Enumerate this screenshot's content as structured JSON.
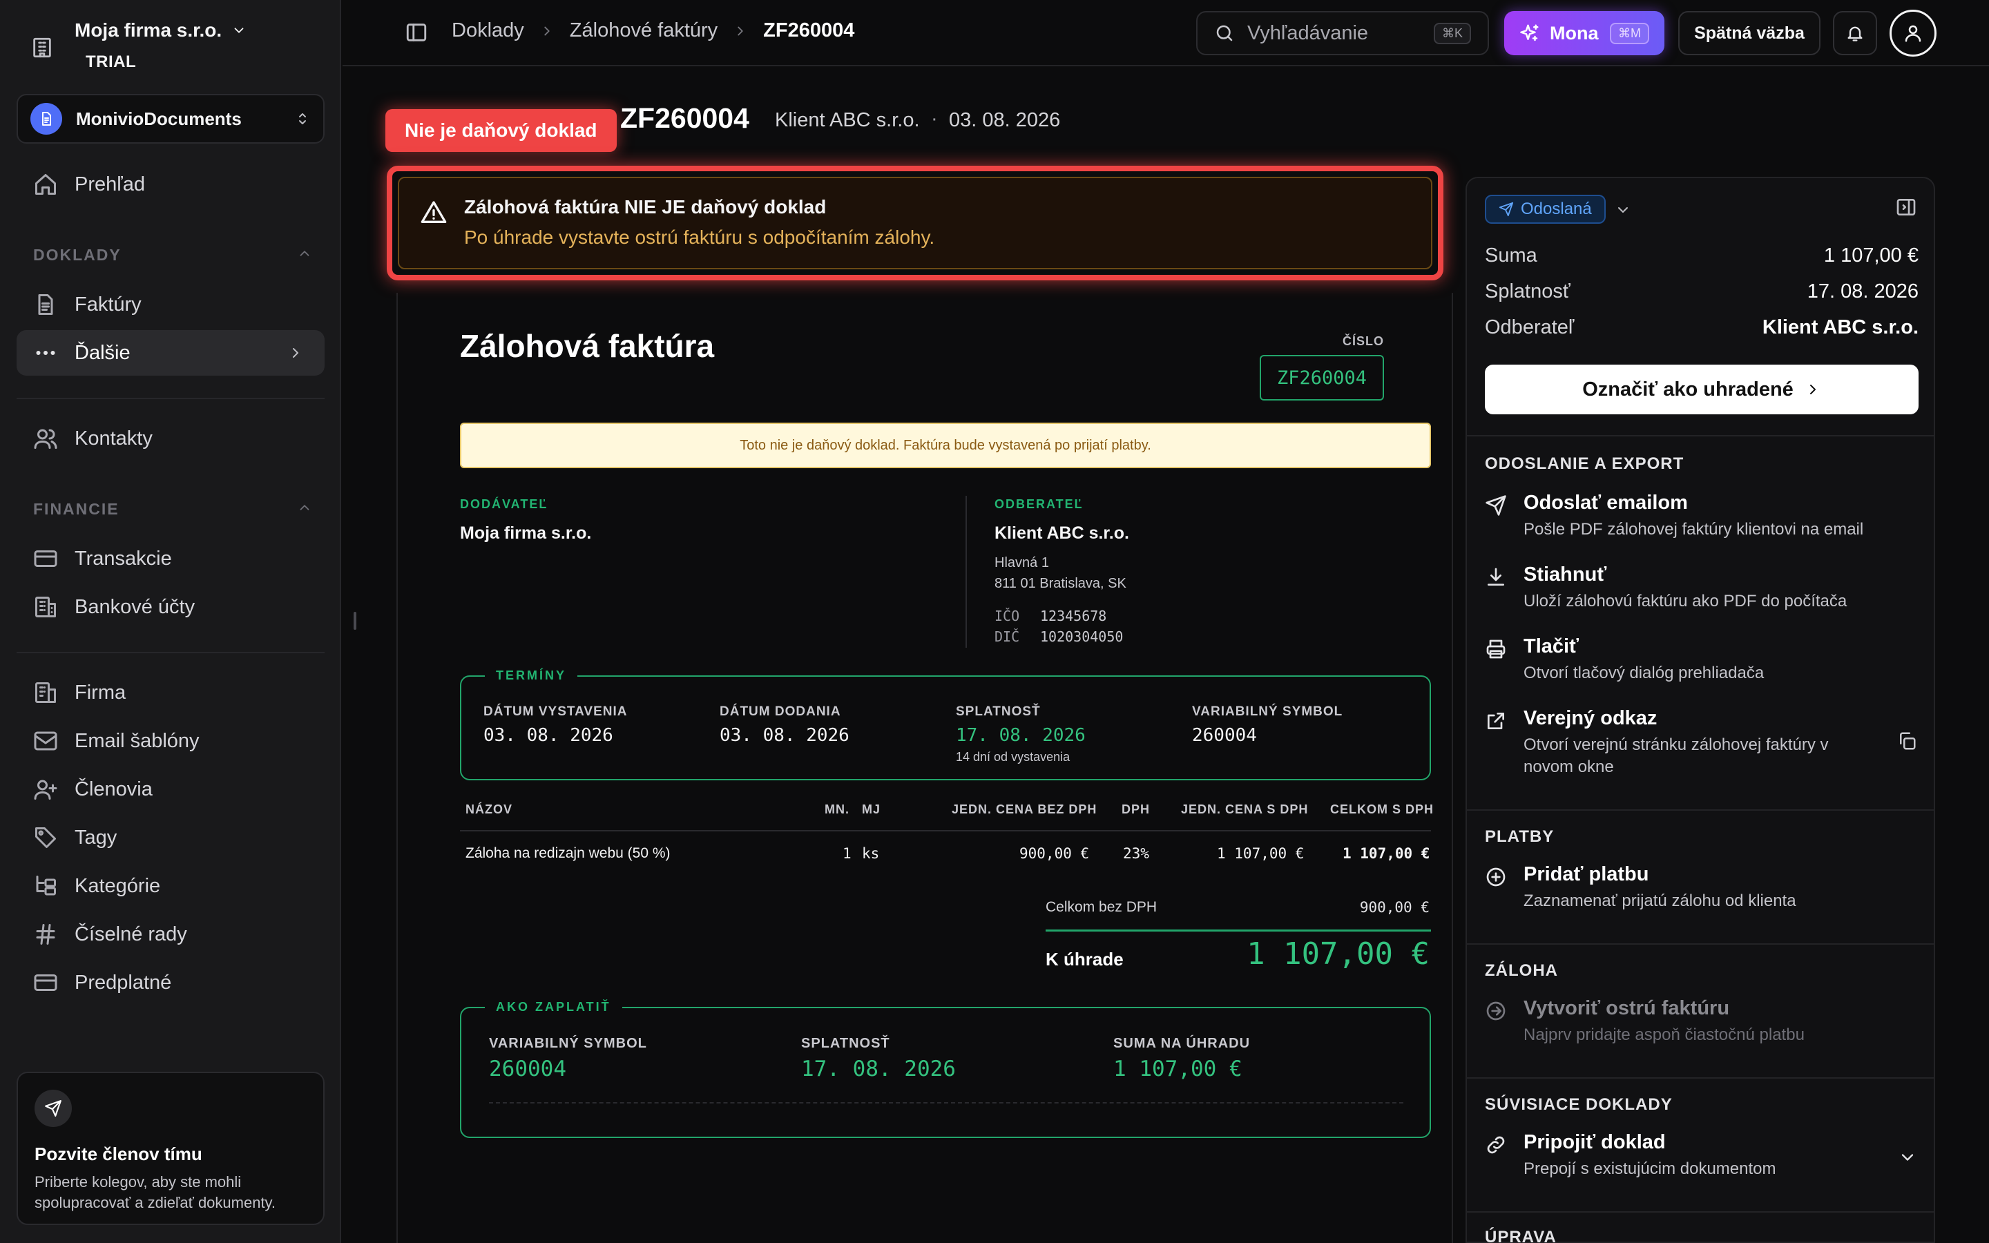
{
  "sidebar": {
    "org_name": "Moja firma s.r.o.",
    "org_plan": "TRIAL",
    "workspace": "MonivioDocuments",
    "nav_overview": "Prehľad",
    "section_docs": "DOKLADY",
    "nav_invoices": "Faktúry",
    "nav_more": "Ďalšie",
    "nav_contacts": "Kontakty",
    "section_finance": "FINANCIE",
    "nav_transactions": "Transakcie",
    "nav_bank": "Bankové účty",
    "nav_company": "Firma",
    "nav_email_templates": "Email šablóny",
    "nav_members": "Členovia",
    "nav_tags": "Tagy",
    "nav_categories": "Kategórie",
    "nav_number_series": "Číselné rady",
    "nav_subscription": "Predplatné",
    "invite_title": "Pozvite členov tímu",
    "invite_text": "Priberte kolegov, aby ste mohli spolupracovať a zdieľať dokumenty."
  },
  "topbar": {
    "crumb_1": "Doklady",
    "crumb_2": "Zálohové faktúry",
    "crumb_3": "ZF260004",
    "search_placeholder": "Vyhľadávanie",
    "search_kbd": "⌘K",
    "mona_label": "Mona",
    "mona_kbd": "⌘M",
    "feedback": "Spätná väzba"
  },
  "header": {
    "not_tax_tag": "Nie je daňový doklad",
    "doc_number": "ZF260004",
    "client": "Klient ABC s.r.o.",
    "dot": "·",
    "date": "03. 08. 2026"
  },
  "warning": {
    "title": "Zálohová faktúra NIE JE daňový doklad",
    "subtitle": "Po úhrade vystavte ostrú faktúru s odpočítaním zálohy."
  },
  "invoice": {
    "title": "Zálohová faktúra",
    "number_label": "ČÍSLO",
    "number": "ZF260004",
    "notice": "Toto nie je daňový doklad. Faktúra bude vystavená po prijatí platby.",
    "supplier_label": "DODÁVATEĽ",
    "supplier_name": "Moja firma s.r.o.",
    "customer_label": "ODBERATEĽ",
    "customer_name": "Klient ABC s.r.o.",
    "customer_street": "Hlavná 1",
    "customer_city": "811 01 Bratislava, SK",
    "ico_label": "IČO",
    "ico": "12345678",
    "dic_label": "DIČ",
    "dic": "1020304050",
    "terms_legend": "TERMÍNY",
    "issue_label": "DÁTUM VYSTAVENIA",
    "issue_date": "03. 08. 2026",
    "delivery_label": "DÁTUM DODANIA",
    "delivery_date": "03. 08. 2026",
    "due_label": "SPLATNOSŤ",
    "due_date": "17. 08. 2026",
    "due_note": "14 dní od vystavenia",
    "vs_label": "VARIABILNÝ SYMBOL",
    "vs": "260004",
    "columns": {
      "name": "NÁZOV",
      "qty": "MN.",
      "unit": "MJ",
      "price_net": "JEDN. CENA BEZ DPH",
      "vat": "DPH",
      "price_gross": "JEDN. CENA S DPH",
      "total": "CELKOM S DPH"
    },
    "row": {
      "name": "Záloha na redizajn webu (50 %)",
      "qty": "1",
      "unit": "ks",
      "price_net": "900,00 €",
      "vat": "23%",
      "price_gross": "1 107,00 €",
      "total": "1 107,00 €"
    },
    "total_net_label": "Celkom bez DPH",
    "total_net": "900,00 €",
    "to_pay_label": "K úhrade",
    "to_pay": "1 107,00 €",
    "howpay_legend": "AKO ZAPLATIŤ",
    "hp_vs_label": "VARIABILNÝ SYMBOL",
    "hp_vs": "260004",
    "hp_due_label": "SPLATNOSŤ",
    "hp_due": "17. 08. 2026",
    "hp_sum_label": "SUMA NA ÚHRADU",
    "hp_sum": "1 107,00 €"
  },
  "panel": {
    "status": "Odoslaná",
    "sum_label": "Suma",
    "sum": "1 107,00 €",
    "due_label": "Splatnosť",
    "due": "17. 08. 2026",
    "customer_label": "Odberateľ",
    "customer": "Klient ABC s.r.o.",
    "mark_paid": "Označiť ako uhradené",
    "sec_export": "ODOSLANIE A EXPORT",
    "email_title": "Odoslať emailom",
    "email_desc": "Pošle PDF zálohovej faktúry klientovi na email",
    "download_title": "Stiahnuť",
    "download_desc": "Uloží zálohovú faktúru ako PDF do počítača",
    "print_title": "Tlačiť",
    "print_desc": "Otvorí tlačový dialóg prehliadača",
    "public_title": "Verejný odkaz",
    "public_desc": "Otvorí verejnú stránku zálohovej faktúry v novom okne",
    "sec_payments": "PLATBY",
    "add_payment_title": "Pridať platbu",
    "add_payment_desc": "Zaznamenať prijatú zálohu od klienta",
    "sec_deposit": "ZÁLOHA",
    "create_invoice_title": "Vytvoriť ostrú faktúru",
    "create_invoice_desc": "Najprv pridajte aspoň čiastočnú platbu",
    "sec_related": "SÚVISIACE DOKLADY",
    "attach_title": "Pripojiť doklad",
    "attach_desc": "Prepojí s existujúcim dokumentom",
    "sec_edit": "ÚPRAVA"
  },
  "colors": {
    "accent_green": "#22b572",
    "danger": "#ef4444",
    "status_blue": "#60a5fa",
    "mona_purple": "#9f3cf5"
  }
}
